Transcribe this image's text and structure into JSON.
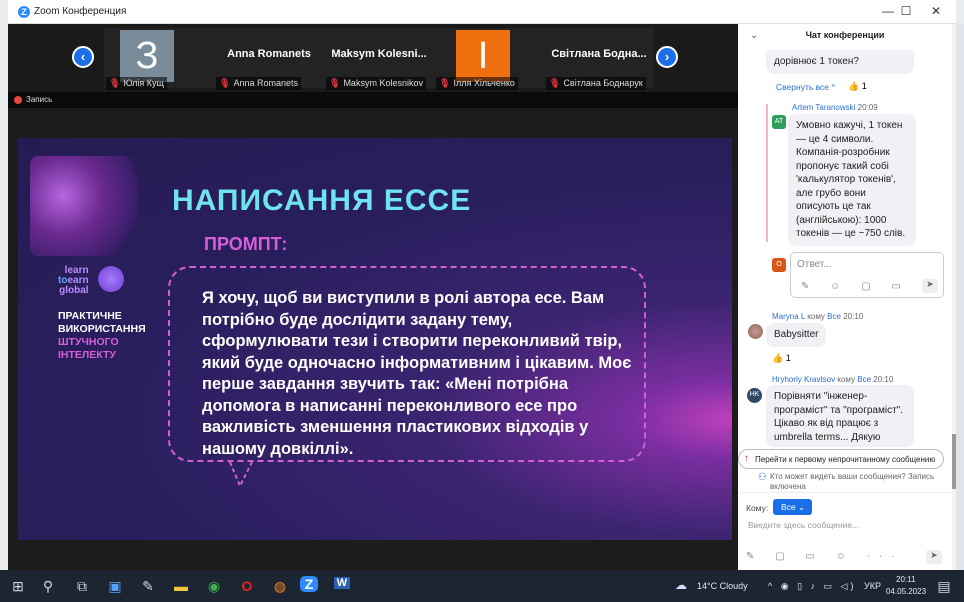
{
  "window": {
    "title": "Zoom Конференция",
    "minimize": "—",
    "maximize": "☐",
    "close": "✕"
  },
  "participants": {
    "prev": "‹",
    "next": "›",
    "tiles": [
      {
        "avatar": "З",
        "avatar_color": "#7a8c99",
        "name": "",
        "label": "Юлія Кущ"
      },
      {
        "avatar": "",
        "name": "Anna Romanets",
        "label": "Anna Romanets"
      },
      {
        "avatar": "",
        "name": "Maksym  Kolesni...",
        "label": "Maksym Kolesnikov"
      },
      {
        "avatar": "І",
        "avatar_color": "#f07010",
        "name": "",
        "label": "Ілля Хільченко"
      },
      {
        "avatar": "",
        "name": "Світлана  Бодна...",
        "label": "Світлана Боднарук"
      }
    ],
    "muted_icon": "🎙"
  },
  "recording": {
    "label": "Запись"
  },
  "slide": {
    "logo": {
      "line1": "learn",
      "line2a": "to",
      "line2b": "earn",
      "line3": "global"
    },
    "course": [
      "ПРАКТИЧНЕ",
      "ВИКОРИСТАННЯ",
      "ШТУЧНОГО",
      "ІНТЕЛЕКТУ"
    ],
    "title": "НАПИСАННЯ ЕССЕ",
    "subtitle": "ПРОМПТ:",
    "prompt": "Я хочу, щоб ви виступили в ролі автора есе. Вам потрібно буде дослідити задану тему, сформулювати тези і створити переконливий твір, який буде одночасно інформативним і цікавим. Моє перше завдання звучить так: «Мені потрібна допомога в написанні переконливого есе про важливість зменшення пластикових відходів у нашому довкіллі»."
  },
  "chat": {
    "title": "Чат конференции",
    "collapse_icon": "⌄",
    "prev_message_tail": "дорівнює 1 токен?",
    "collapse_all": "Свернуть все ^",
    "reaction1": "👍 1",
    "reply": {
      "avatar": "AT",
      "author": "Artem Taranowski",
      "time": "20:09",
      "text": "Умовно кажучі, 1 токен — це 4 символи. Компанія-розробник пропонує такий собі 'калькулятор токенів', але грубо вони описують це так (англійською): 1000 токенів — це ~750 слів."
    },
    "reply_box": {
      "avatar": "О",
      "placeholder": "Ответ...",
      "tools": "✎ ☺ ▢ ▭",
      "send": "➤"
    },
    "messages": [
      {
        "author": "Maryna L",
        "to": "кому",
        "recipient": "Все",
        "time": "20:10",
        "text": "Babysitter",
        "reaction": "👍 1"
      },
      {
        "avatar": "HK",
        "author": "Hryhoriy Kravtsov",
        "to": "кому",
        "recipient": "Все",
        "time": "20:10",
        "text": "Порівняти \"інженер-програміст\" та \"програміст\". Цікаво як від працює з umbrella terms... Дякую"
      }
    ],
    "jump_unread": "Перейти к первому непрочитанному сообщению",
    "privacy_note": "Кто может видеть ваши сообщения? Запись включена",
    "to_label": "Кому:",
    "to_value": "Все",
    "input_placeholder": "Введите здесь сообщение...",
    "input_tools": "✎ ▢ ▭ ☺ ···",
    "send": "➤"
  },
  "taskbar": {
    "icons": [
      "⊞",
      "⚲",
      "⧉",
      "▣",
      "✎",
      "▬",
      "◉",
      "O",
      "◍",
      "Z",
      "W"
    ],
    "weather": "14°C  Cloudy",
    "tray": "^ ◉ ▯ ♪ ▭ ◁)",
    "lang": "УКР",
    "time": "20:11",
    "date": "04.05.2023",
    "notifications": "▤"
  }
}
